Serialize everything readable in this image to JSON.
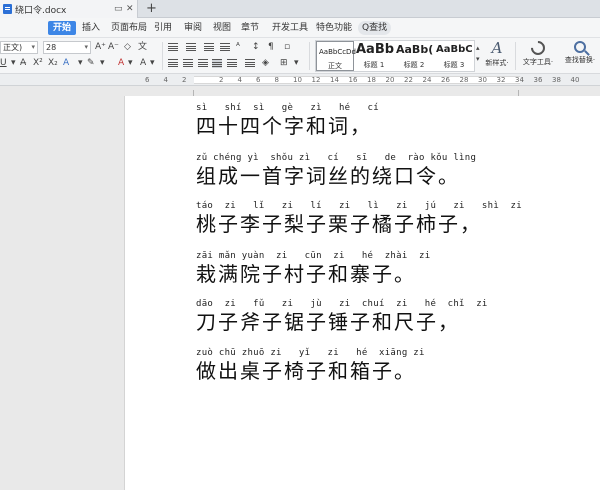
{
  "titlebar": {
    "doc_name": "绕口令.docx",
    "window_btn": "▭",
    "close_btn": "✕",
    "new_tab": "+"
  },
  "menu": {
    "items": [
      "开始",
      "插入",
      "页面布局",
      "引用",
      "审阅",
      "视图",
      "章节",
      "开发工具",
      "特色功能"
    ],
    "search": "Q查找"
  },
  "ribbon": {
    "font_name": "正文)",
    "font_size": "28",
    "styles": [
      {
        "sample": "AaBbCcDd",
        "name": "正文"
      },
      {
        "sample": "AaBb",
        "name": "标题 1"
      },
      {
        "sample": "AaBb(",
        "name": "标题 2"
      },
      {
        "sample": "AaBbC",
        "name": "标题 3"
      }
    ],
    "new_style": "新样式·",
    "text_tools": "文字工具·",
    "find_replace": "查找替换·"
  },
  "ruler": {
    "numbers": [
      "6",
      "4",
      "2",
      "",
      "2",
      "4",
      "6",
      "8",
      "10",
      "12",
      "14",
      "16",
      "18",
      "20",
      "22",
      "24",
      "26",
      "28",
      "30",
      "32",
      "34",
      "36",
      "38",
      "40"
    ]
  },
  "document": {
    "lines": [
      {
        "pinyin": "sì   shí  sì   gè   zì   hé   cí",
        "hanzi": "四十四个字和词，"
      },
      {
        "pinyin": "zǔ chéng yì  shǒu zì   cí   sī   de  rào kǒu lìng",
        "hanzi": "组成一首字词丝的绕口令。"
      },
      {
        "pinyin": "táo  zi   lǐ   zi   lí   zi   lì   zi   jú   zi   shì  zi",
        "hanzi": "桃子李子梨子栗子橘子柿子，"
      },
      {
        "pinyin": "zāi mǎn yuàn  zi   cūn  zi   hé  zhài  zi",
        "hanzi": "栽满院子村子和寨子。"
      },
      {
        "pinyin": "dāo  zi   fǔ   zi   jù   zi  chuí  zi   hé  chǐ  zi",
        "hanzi": "刀子斧子锯子锤子和尺子，"
      },
      {
        "pinyin": "zuò chū zhuō zi   yǐ   zi   hé  xiāng zi",
        "hanzi": "做出桌子椅子和箱子。"
      }
    ]
  }
}
